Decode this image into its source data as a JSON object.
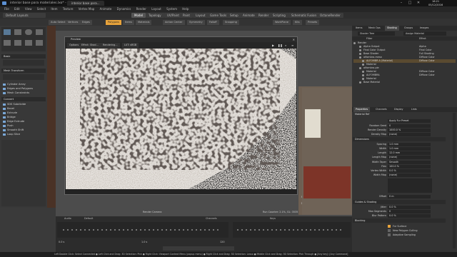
{
  "window": {
    "title": "interior base para materiales.lxo* - MODO",
    "tabs": [
      "interior base para..."
    ],
    "clock": {
      "time": "16:21",
      "date": "05/12/2016"
    }
  },
  "menubar": [
    "File",
    "Edit",
    "View",
    "Select",
    "Item",
    "Texture",
    "Vertex Map",
    "Animate",
    "Dynamics",
    "Render",
    "Layout",
    "System",
    "Help"
  ],
  "modebar": {
    "layout": "Default Layouts",
    "tabs": [
      "Model",
      "Topology",
      "UV/Paint",
      "Paint",
      "Layout",
      "Game Tools",
      "Setup",
      "Animate",
      "Render",
      "Scripting",
      "Schematic Fusion",
      "OctaneRender"
    ]
  },
  "toolbar": [
    "Auto Select",
    "Vertices",
    "Edges",
    "Polygons",
    "Items",
    "Materials",
    "Action Center",
    "Symmetry",
    "Falloff",
    "Snapping",
    "WorkPlane",
    "Kits",
    "Presets"
  ],
  "left_panel": {
    "sections": [
      "Basic",
      "Mesh Transform",
      "Convert"
    ],
    "buttons": [
      "Cylinder Array",
      "Edges and Polygons",
      "Mesh Constraints",
      "SDS Subdivide",
      "Bevel",
      "Extrude",
      "Bridge",
      "Edge Extrude",
      "Push",
      "Smooth Shift",
      "Loop Slice"
    ],
    "top_labels": [
      "Pen",
      "Create",
      "Move Tool",
      "Polygon Tools"
    ]
  },
  "preview": {
    "title": "Preview",
    "tabs": [
      "Options",
      "Effect: Shad...",
      "Rendering...",
      "LUT: sRGB"
    ],
    "subtabs": [
      "sRGB",
      "Shading Pixel"
    ]
  },
  "viewport": {
    "info": [
      "Polygons : Face",
      "Channels : 0",
      "Deformers : ON",
      "GL : 5,370",
      "100 mm"
    ],
    "info2": [
      "All Polygons",
      "Channels : 0",
      "Deformers : ON",
      "GL : 4,860",
      "Locked"
    ],
    "caption": "Render Camera",
    "caption2": "Run Counter: 2.1%, GL: 3535"
  },
  "timeline": {
    "headers": [
      "Audio",
      "Default",
      "Channels",
      "Keys"
    ],
    "values": [
      "0.0 s",
      "1.0 s",
      "120"
    ]
  },
  "statusbar": "Left Double Click: Select Connected ● Left Click and Drag: 3D Selection: Pick ● Right Click: Viewport Context Menu (popup menu) ● Right Click and Drag: 3D Selection: Lasso ● Middle Click and Drag: 3D Selection: Pick Through ● [Any key]: [Any Command]",
  "right_panel": {
    "top_tabs": [
      "Items",
      "Mesh Ops",
      "Shading",
      "Groups",
      "Images"
    ],
    "filter_label": "Shader Tree",
    "filter_value": "Assign Material",
    "cols": [
      "Filter",
      "Effect"
    ],
    "tree": [
      {
        "name": "Render",
        "effect": ""
      },
      {
        "name": "Alpha Output",
        "effect": "Alpha"
      },
      {
        "name": "Final Color Output",
        "effect": "Final Color"
      },
      {
        "name": "Base Shader",
        "effect": "Full Shading"
      },
      {
        "name": "alfombra-mesa",
        "effect": "Diffuse Color"
      },
      {
        "name": "ALFOMBR A (Material)",
        "effect": "Diffuse Color"
      },
      {
        "name": "Material",
        "effect": ""
      },
      {
        "name": "alfombra-pie",
        "effect": ""
      },
      {
        "name": "Material",
        "effect": "Diffuse Color"
      },
      {
        "name": "ALFOMBRA",
        "effect": "Diffuse Color"
      },
      {
        "name": "Material",
        "effect": ""
      },
      {
        "name": "Base Material",
        "effect": ""
      }
    ],
    "props_tabs": [
      "Properties",
      "Channels",
      "Display",
      "Lists"
    ],
    "props_header": "Material Ref",
    "props": [
      {
        "label": "Apply Fur Preset",
        "value": ""
      },
      {
        "label": "Random Seed",
        "value": "0"
      },
      {
        "label": "Render Density",
        "value": "1000.0 %"
      },
      {
        "label": "Density Map",
        "value": "(none)"
      },
      {
        "label": "Spacing",
        "value": "1.0 mm"
      },
      {
        "label": "Width",
        "value": "1.0 mm"
      },
      {
        "label": "Length",
        "value": "12.0 mm"
      },
      {
        "label": "Length Map",
        "value": "(none)"
      },
      {
        "label": "Width Taper",
        "value": "Smooth"
      },
      {
        "label": "Flex",
        "value": "100.0 %"
      },
      {
        "label": "Vertex Width",
        "value": "0.0 %"
      },
      {
        "label": "Width Map",
        "value": "(none)"
      },
      {
        "label": "Offset",
        "value": "0 m"
      },
      {
        "label": "Jitter",
        "value": "0.0 %"
      },
      {
        "label": "Max Segments",
        "value": "0"
      },
      {
        "label": "Blur Pattern",
        "value": "0.0 %"
      }
    ],
    "sections": [
      "Dimensions",
      "Guides & Shading",
      "Blocking"
    ],
    "checkboxes": [
      "Fur Surface",
      "New Polygon Culling",
      "Adaptive Sampling"
    ]
  },
  "colors": {
    "accent_orange": "#e8a33b",
    "selected_row": "#5a4a30",
    "preview_bg": "#000000",
    "carpet_light": "#d8d2c8"
  }
}
